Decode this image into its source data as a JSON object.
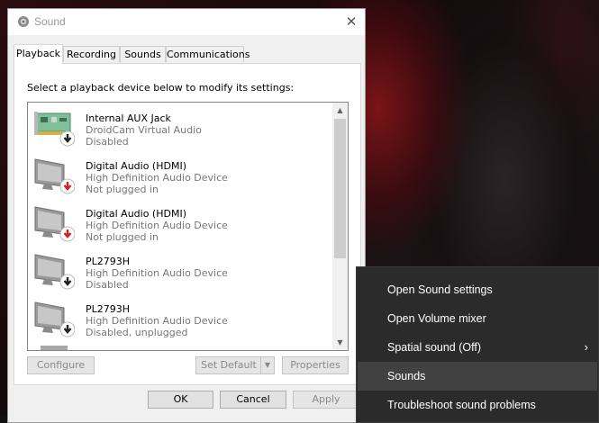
{
  "window": {
    "title": "Sound",
    "close_glyph": "✕"
  },
  "tabs": [
    {
      "label": "Playback"
    },
    {
      "label": "Recording"
    },
    {
      "label": "Sounds"
    },
    {
      "label": "Communications"
    }
  ],
  "instruction": "Select a playback device below to modify its settings:",
  "devices": [
    {
      "name": "Internal AUX Jack",
      "description": "DroidCam Virtual Audio",
      "status": "Disabled",
      "icon": "sound-card-icon",
      "badge": "down-arrow-black"
    },
    {
      "name": "Digital Audio (HDMI)",
      "description": "High Definition Audio Device",
      "status": "Not plugged in",
      "icon": "monitor-icon",
      "badge": "down-arrow-red"
    },
    {
      "name": "Digital Audio (HDMI)",
      "description": "High Definition Audio Device",
      "status": "Not plugged in",
      "icon": "monitor-icon",
      "badge": "down-arrow-red"
    },
    {
      "name": "PL2793H",
      "description": "High Definition Audio Device",
      "status": "Disabled",
      "icon": "monitor-icon",
      "badge": "down-arrow-black"
    },
    {
      "name": "PL2793H",
      "description": "High Definition Audio Device",
      "status": "Disabled, unplugged",
      "icon": "monitor-icon",
      "badge": "down-arrow-black"
    }
  ],
  "buttons": {
    "configure": "Configure",
    "set_default": "Set Default",
    "properties": "Properties",
    "ok": "OK",
    "cancel": "Cancel",
    "apply": "Apply"
  },
  "context_menu": {
    "items": [
      {
        "label": "Open Sound settings"
      },
      {
        "label": "Open Volume mixer"
      },
      {
        "label": "Spatial sound (Off)",
        "has_submenu": true
      },
      {
        "label": "Sounds",
        "highlighted": true
      },
      {
        "label": "Troubleshoot sound problems"
      }
    ]
  },
  "colors": {
    "menu_bg": "#2b2b2b",
    "menu_hover": "#414141",
    "unplugged_badge": "#d32020"
  }
}
